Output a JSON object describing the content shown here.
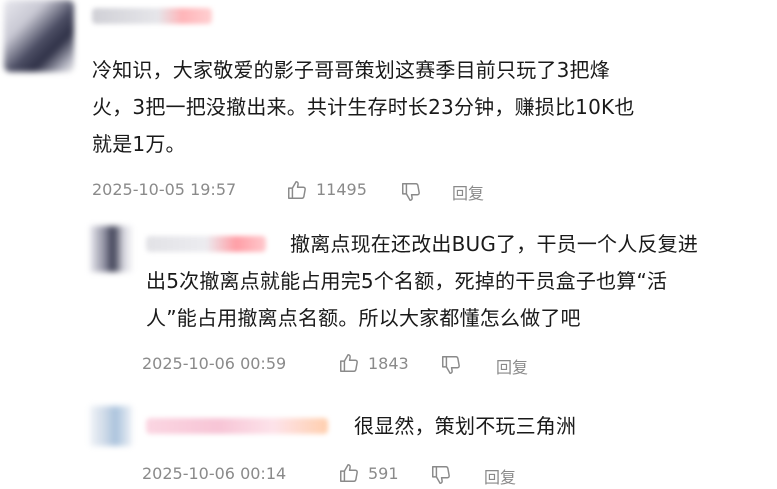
{
  "comments": [
    {
      "id": "main",
      "text_lines": [
        "冷知识，大家敬爱的影子哥哥策划这赛季目前只玩了3把烽",
        "火，3把一把没撤出来。共计生存时长23分钟，赚损比10K也",
        "就是1万。"
      ],
      "timestamp": "2025-10-05 19:57",
      "likes": "11495",
      "reply_label": "回复"
    },
    {
      "id": "reply1",
      "text_lines": [
        "撤离点现在还改出BUG了，干员一个人反复进",
        "出5次撤离点就能占用完5个名额，死掉的干员盒子也算“活",
        "人”能占用撤离点名额。所以大家都懂怎么做了吧"
      ],
      "timestamp": "2025-10-06 00:59",
      "likes": "1843",
      "reply_label": "回复"
    },
    {
      "id": "reply2",
      "text_lines": [
        "很显然，策划不玩三角洲"
      ],
      "timestamp": "2025-10-06 00:14",
      "likes": "591",
      "reply_label": "回复"
    }
  ],
  "icons": {
    "like": "thumbs-up-icon",
    "dislike": "thumbs-down-icon"
  },
  "colors": {
    "text": "#1a1a1a",
    "meta": "#8a8a8a"
  }
}
